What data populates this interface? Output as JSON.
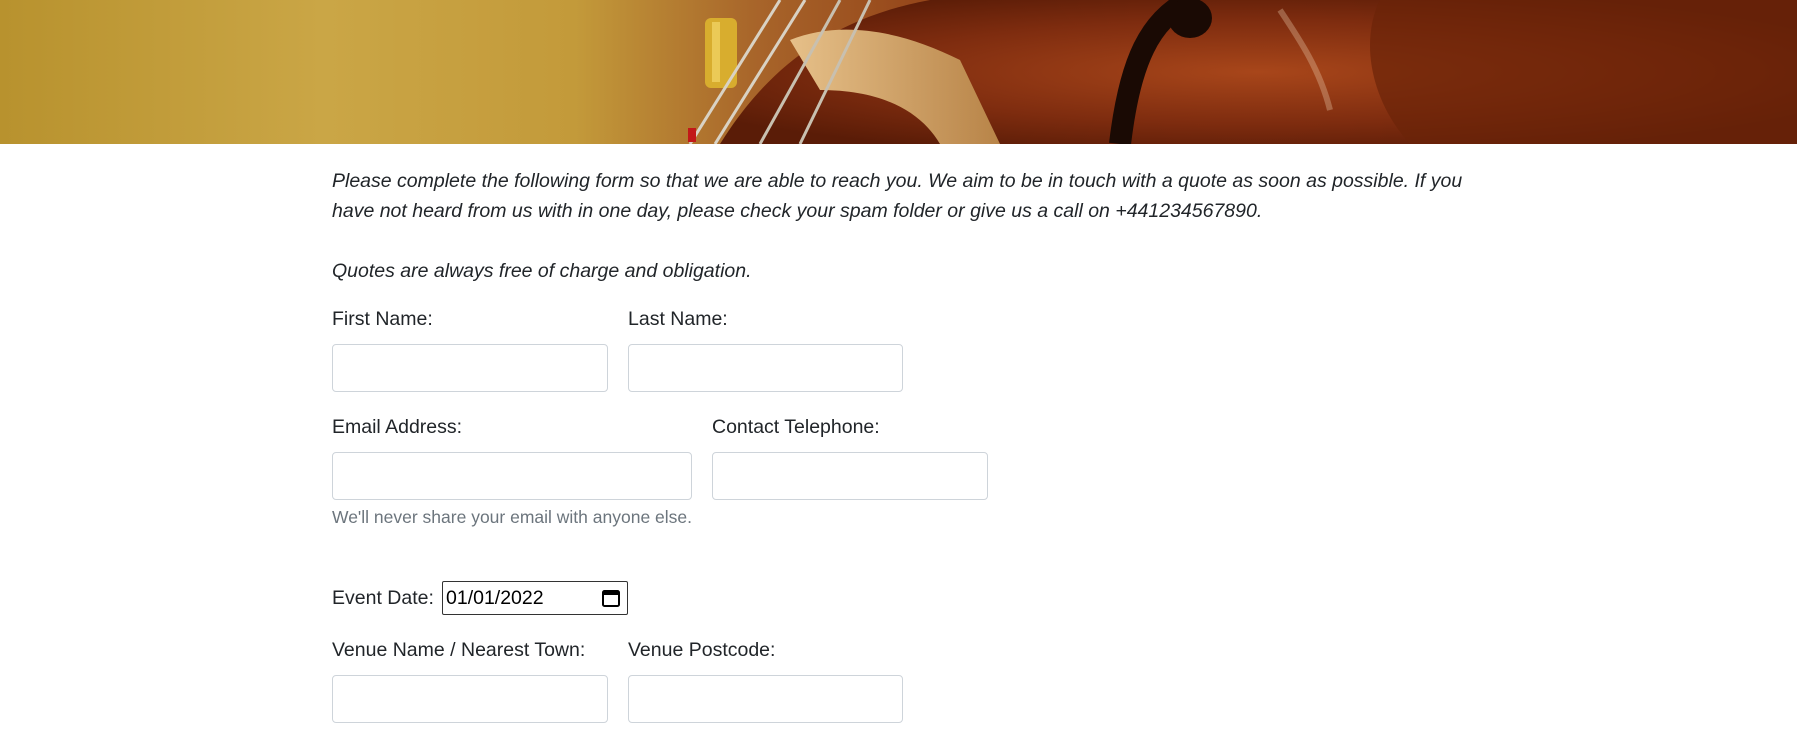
{
  "hero": {
    "image_icon": "cello-photo"
  },
  "intro": {
    "paragraph": "Please complete the following form so that we are able to reach you. We aim to be in touch with a quote as soon as possible. If you have not heard from us with in one day, please check your spam folder or give us a call on +441234567890.",
    "note": "Quotes are always free of charge and obligation."
  },
  "form": {
    "first_name_label": "First Name:",
    "last_name_label": "Last Name:",
    "email_label": "Email Address:",
    "phone_label": "Contact Telephone:",
    "email_help": "We'll never share your email with anyone else.",
    "event_date_label": "Event Date:",
    "event_date_value": "01/01/2022",
    "venue_label": "Venue Name / Nearest Town:",
    "postcode_label": "Venue Postcode:",
    "first_name_value": "",
    "last_name_value": "",
    "email_value": "",
    "phone_value": "",
    "venue_value": "",
    "postcode_value": ""
  }
}
